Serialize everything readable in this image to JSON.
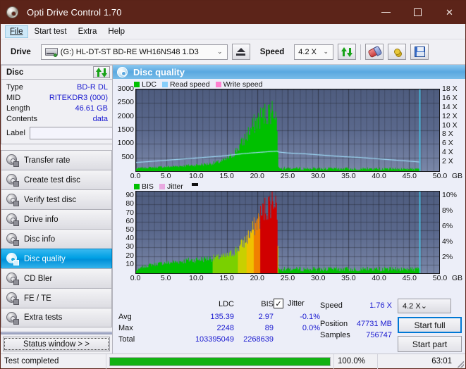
{
  "window": {
    "title": "Opti Drive Control 1.70",
    "icon": "disc-icon",
    "minimize": "–",
    "maximize": "□",
    "close": "✕"
  },
  "menu": {
    "items": [
      {
        "label": "File",
        "active": true
      },
      {
        "label": "Start test",
        "active": false
      },
      {
        "label": "Extra",
        "active": false
      },
      {
        "label": "Help",
        "active": false
      }
    ]
  },
  "toolbar": {
    "drive_label": "Drive",
    "drive_value": "(G:)  HL-DT-ST BD-RE  WH16NS48 1.D3",
    "eject_icon": "eject-icon",
    "speed_label": "Speed",
    "speed_value": "4.2 X",
    "refresh_icon": "refresh-icon",
    "erase_icon": "eraser-icon",
    "settings_icon": "gears-icon",
    "save_icon": "floppy-save-icon",
    "caret": "⌄"
  },
  "disc": {
    "panel_title": "Disc",
    "refresh_icon": "refresh-icon",
    "fields": [
      {
        "key": "Type",
        "value": "BD-R DL"
      },
      {
        "key": "MID",
        "value": "RITEKDR3 (000)"
      },
      {
        "key": "Length",
        "value": "46.61 GB"
      },
      {
        "key": "Contents",
        "value": "data"
      }
    ],
    "label_key": "Label",
    "label_value": "",
    "label_placeholder": "",
    "label_button_icon": "disc-label-icon"
  },
  "nav": {
    "items": [
      {
        "label": "Transfer rate",
        "selected": false
      },
      {
        "label": "Create test disc",
        "selected": false
      },
      {
        "label": "Verify test disc",
        "selected": false
      },
      {
        "label": "Drive info",
        "selected": false
      },
      {
        "label": "Disc info",
        "selected": false
      },
      {
        "label": "Disc quality",
        "selected": true
      },
      {
        "label": "CD Bler",
        "selected": false
      },
      {
        "label": "FE / TE",
        "selected": false
      },
      {
        "label": "Extra tests",
        "selected": false
      }
    ],
    "status_window": "Status window > >"
  },
  "main": {
    "header_title": "Disc quality",
    "header_icon": "disc-quality-icon"
  },
  "stats": {
    "col_ldc": "LDC",
    "col_bis": "BIS",
    "jitter_label": "Jitter",
    "jitter_checked": true,
    "check_glyph": "✓",
    "rows": [
      {
        "label": "Avg",
        "ldc": "135.39",
        "bis": "2.97",
        "jitter": "-0.1%"
      },
      {
        "label": "Max",
        "ldc": "2248",
        "bis": "89",
        "jitter": "0.0%"
      },
      {
        "label": "Total",
        "ldc": "103395049",
        "bis": "2268639",
        "jitter": ""
      }
    ],
    "speed_label": "Speed",
    "speed_value": "1.76 X",
    "position_label": "Position",
    "position_value": "47731 MB",
    "samples_label": "Samples",
    "samples_value": "756747",
    "speed_select": "4.2 X",
    "caret": "⌄",
    "start_full": "Start full",
    "start_part": "Start part"
  },
  "statusbar": {
    "message": "Test completed",
    "progress_percent": 100.0,
    "progress_text": "100.0%",
    "elapsed": "63:01"
  },
  "chart_data": [
    {
      "id": "ldc-chart",
      "type": "area",
      "title": "",
      "xlabel": "GB",
      "ylabel": "",
      "grid": true,
      "legend_position": "top-left",
      "legend": [
        {
          "name": "LDC",
          "color": "#00c000"
        },
        {
          "name": "Read speed",
          "color": "#87cefa"
        },
        {
          "name": "Write speed",
          "color": "#ff80d0"
        }
      ],
      "xlim": [
        0,
        50
      ],
      "xticks": [
        0.0,
        5.0,
        10.0,
        15.0,
        20.0,
        25.0,
        30.0,
        35.0,
        40.0,
        45.0,
        50.0
      ],
      "xticklabels": [
        "0.0",
        "5.0",
        "10.0",
        "15.0",
        "20.0",
        "25.0",
        "30.0",
        "35.0",
        "40.0",
        "45.0",
        "50.0"
      ],
      "ylim": [
        0,
        3000
      ],
      "yticks": [
        500,
        1000,
        1500,
        2000,
        2500,
        3000
      ],
      "yticklabels": [
        "500",
        "1000",
        "1500",
        "2000",
        "2500",
        "3000"
      ],
      "y2lim": [
        0,
        18
      ],
      "y2ticks": [
        2,
        4,
        6,
        8,
        10,
        12,
        14,
        16,
        18
      ],
      "y2ticklabels": [
        "2 X",
        "4 X",
        "6 X",
        "8 X",
        "10 X",
        "12 X",
        "14 X",
        "16 X",
        "18 X"
      ],
      "end_marker_x": 46.8,
      "end_marker_color": "#40d0f0",
      "series": [
        {
          "name": "LDC",
          "type": "area",
          "color": "#00c000",
          "x": [
            0.0,
            0.5,
            1.0,
            1.5,
            2.0,
            2.5,
            3.0,
            3.5,
            4.0,
            4.5,
            5.0,
            5.5,
            6.0,
            6.5,
            7.0,
            7.5,
            8.0,
            8.5,
            9.0,
            9.5,
            10.0,
            10.5,
            11.0,
            11.5,
            12.0,
            12.5,
            13.0,
            13.5,
            14.0,
            14.5,
            15.0,
            15.5,
            16.0,
            16.5,
            17.0,
            17.5,
            18.0,
            18.5,
            19.0,
            19.5,
            20.0,
            20.5,
            21.0,
            21.5,
            22.0,
            22.5,
            22.9,
            23.2,
            23.4,
            24.0,
            25.0,
            27.0,
            29.0,
            31.0,
            33.0,
            35.0,
            37.0,
            39.0,
            41.0,
            43.0,
            45.0,
            46.5
          ],
          "values": [
            90,
            110,
            120,
            125,
            130,
            135,
            140,
            145,
            150,
            155,
            160,
            165,
            170,
            175,
            180,
            190,
            200,
            205,
            210,
            215,
            225,
            235,
            245,
            255,
            265,
            280,
            300,
            330,
            360,
            400,
            450,
            520,
            620,
            760,
            900,
            1060,
            1230,
            1400,
            1560,
            1720,
            1860,
            1960,
            2040,
            2110,
            2180,
            2248,
            2200,
            1700,
            200,
            90,
            85,
            80,
            78,
            76,
            75,
            74,
            73,
            72,
            70,
            68,
            66,
            60
          ]
        },
        {
          "name": "Read speed",
          "type": "line",
          "axis": "y2",
          "color": "#9fdcf8",
          "x": [
            0.0,
            2.0,
            4.0,
            6.0,
            8.0,
            10.0,
            12.0,
            14.0,
            16.0,
            18.0,
            20.0,
            22.0,
            23.3,
            23.5,
            25.0,
            28.0,
            31.0,
            34.0,
            37.0,
            40.0,
            43.0,
            46.0,
            46.8
          ],
          "values": [
            1.9,
            2.1,
            2.3,
            2.5,
            2.7,
            2.9,
            3.1,
            3.3,
            3.6,
            3.9,
            4.1,
            4.3,
            4.4,
            4.2,
            4.0,
            3.8,
            3.5,
            3.2,
            3.0,
            2.7,
            2.4,
            2.1,
            2.0
          ]
        },
        {
          "name": "Write speed",
          "type": "line",
          "color": "#ff80d0",
          "x": [],
          "values": []
        }
      ]
    },
    {
      "id": "bis-chart",
      "type": "area",
      "title": "",
      "xlabel": "GB",
      "grid": true,
      "legend_position": "top-left",
      "legend": [
        {
          "name": "BIS",
          "color": "#00c000"
        },
        {
          "name": "Jitter",
          "color": "#e8a8e0"
        }
      ],
      "xlim": [
        0,
        50
      ],
      "xticks": [
        0.0,
        5.0,
        10.0,
        15.0,
        20.0,
        25.0,
        30.0,
        35.0,
        40.0,
        45.0,
        50.0
      ],
      "xticklabels": [
        "0.0",
        "5.0",
        "10.0",
        "15.0",
        "20.0",
        "25.0",
        "30.0",
        "35.0",
        "40.0",
        "45.0",
        "50.0"
      ],
      "ylim": [
        0,
        95
      ],
      "yticks": [
        10,
        20,
        30,
        40,
        50,
        60,
        70,
        80,
        90
      ],
      "yticklabels": [
        "10",
        "20",
        "30",
        "40",
        "50",
        "60",
        "70",
        "80",
        "90"
      ],
      "y2lim": [
        0,
        10.5
      ],
      "y2ticks": [
        2,
        4,
        6,
        8,
        10
      ],
      "y2ticklabels": [
        "2%",
        "4%",
        "6%",
        "8%",
        "10%"
      ],
      "end_marker_x": 46.8,
      "end_marker_color": "#40d0f0",
      "series": [
        {
          "name": "BIS",
          "type": "area",
          "color_scale": "green-yellow-orange-red",
          "x": [
            0.0,
            0.5,
            1.0,
            1.5,
            2.0,
            2.5,
            3.0,
            3.5,
            4.0,
            4.5,
            5.0,
            5.5,
            6.0,
            6.5,
            7.0,
            7.5,
            8.0,
            8.5,
            9.0,
            9.5,
            10.0,
            10.5,
            11.0,
            11.5,
            12.0,
            12.5,
            13.0,
            13.5,
            14.0,
            14.5,
            15.0,
            15.5,
            16.0,
            16.5,
            17.0,
            17.5,
            18.0,
            18.5,
            19.0,
            19.5,
            20.0,
            20.5,
            21.0,
            21.5,
            22.0,
            22.5,
            22.9,
            23.2,
            23.4,
            24.0,
            25.0,
            27.0,
            29.0,
            31.0,
            33.0,
            35.0,
            37.0,
            39.0,
            41.0,
            43.0,
            45.0,
            46.5
          ],
          "values": [
            3,
            5,
            7,
            8,
            9,
            10,
            10,
            11,
            11,
            12,
            12,
            12,
            13,
            13,
            13,
            14,
            14,
            15,
            15,
            15,
            16,
            16,
            16,
            17,
            17,
            17,
            18,
            18,
            19,
            19,
            20,
            22,
            24,
            27,
            30,
            34,
            38,
            43,
            48,
            54,
            60,
            66,
            72,
            76,
            80,
            85,
            90,
            72,
            8,
            4,
            4,
            4,
            4,
            4,
            4,
            4,
            4,
            4,
            4,
            4,
            4,
            4
          ]
        },
        {
          "name": "Jitter",
          "type": "line",
          "axis": "y2",
          "color": "#e8a8e0",
          "x": [],
          "values": []
        }
      ]
    }
  ]
}
